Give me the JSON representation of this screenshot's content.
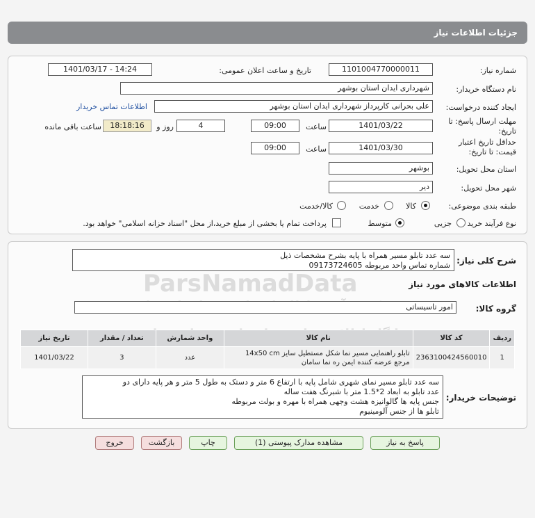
{
  "header": {
    "title": "جزئیات اطلاعات نیاز"
  },
  "form": {
    "need_number_label": "شماره نیاز:",
    "need_number": "1101004770000011",
    "announce_label": "تاریخ و ساعت اعلان عمومی:",
    "announce_value": "1401/03/17 - 14:24",
    "buyer_label": "نام دستگاه خریدار:",
    "buyer_value": "شهرداری ایدان استان بوشهر",
    "requester_label": "ایجاد کننده درخواست:",
    "requester_value": "علی بحرانی کارپرداز شهرداری ایدان استان بوشهر",
    "contact_link": "اطلاعات تماس خریدار",
    "deadline_label": "مهلت ارسال پاسخ: تا تاریخ:",
    "deadline_date": "1401/03/22",
    "time_label": "ساعت",
    "deadline_time": "09:00",
    "days_value": "4",
    "days_label": "روز و",
    "remaining_time": "18:18:16",
    "remaining_label": "ساعت باقی مانده",
    "validity_label": "حداقل تاریخ اعتبار قیمت: تا تاریخ:",
    "validity_date": "1401/03/30",
    "validity_time": "09:00",
    "province_label": "استان محل تحویل:",
    "province_value": "بوشهر",
    "city_label": "شهر محل تحویل:",
    "city_value": "دیر",
    "category_label": "طبقه بندی موضوعی:",
    "category_options": [
      "کالا",
      "خدمت",
      "کالا/خدمت"
    ],
    "category_selected": "کالا",
    "process_label": "نوع فرآیند خرید :",
    "process_options": [
      "جزیی",
      "متوسط"
    ],
    "process_selected": "متوسط",
    "payment_note": "پرداخت تمام یا بخشی از مبلغ خرید،از محل \"اسناد خزانه اسلامی\" خواهد بود."
  },
  "details": {
    "summary_label": "شرح کلی نیاز:",
    "summary_lines": [
      "سه عدد تابلو مسیر همراه با پایه بشرح مشخصات ذیل",
      "شماره تماس واحد مربوطه 09173724605"
    ],
    "goods_info_title": "اطلاعات کالاهای مورد نیاز",
    "group_label": "گروه کالا:",
    "group_value": "امور تاسیساتی",
    "table": {
      "headers": [
        "ردیف",
        "کد کالا",
        "نام کالا",
        "واحد شمارش",
        "تعداد / مقدار",
        "تاریخ نیاز"
      ],
      "rows": [
        {
          "row": "1",
          "code": "2363100424560010",
          "name_line1": "تابلو راهنمایی مسیر نما شکل مستطیل سایز 14x50 cm",
          "name_line2": "مرجع عرضه کننده ایمن ره نما سامان",
          "unit": "عدد",
          "qty": "3",
          "date": "1401/03/22"
        }
      ]
    },
    "buyer_notes_label": "توضیحات خریدار:",
    "buyer_notes_lines": [
      "سه عدد تابلو مسیر نمای شهری شامل پایه با ارتفاع 6 متر و دستک به طول 5 متر و هر پایه دارای دو",
      "عدد تابلو به ابعاد 2*1.5 متر با شبرنگ هفت ساله",
      "جنس پایه ها گالوانیزه هشت وجهی همراه با مهره و بولت مربوطه",
      "تابلو ها از جنس آلومینیوم"
    ]
  },
  "buttons": {
    "reply": "پاسخ به نیاز",
    "attachments": "مشاهده مدارک پیوستی (1)",
    "print": "چاپ",
    "back": "بازگشت",
    "exit": "خروج"
  },
  "watermark": {
    "line1": "ParsNamadData",
    "line2": "مرکز فرآوری اطلاعات پارس نماد داده ها",
    "line3": "پایگاه اطلاع رسانی مناقصات و مزایده ها",
    "phone": "021-88349670"
  },
  "colors": {
    "header_bg": "#8a8c8f",
    "link": "#1f4fa0",
    "remaining_bg": "#f2ebc9"
  }
}
